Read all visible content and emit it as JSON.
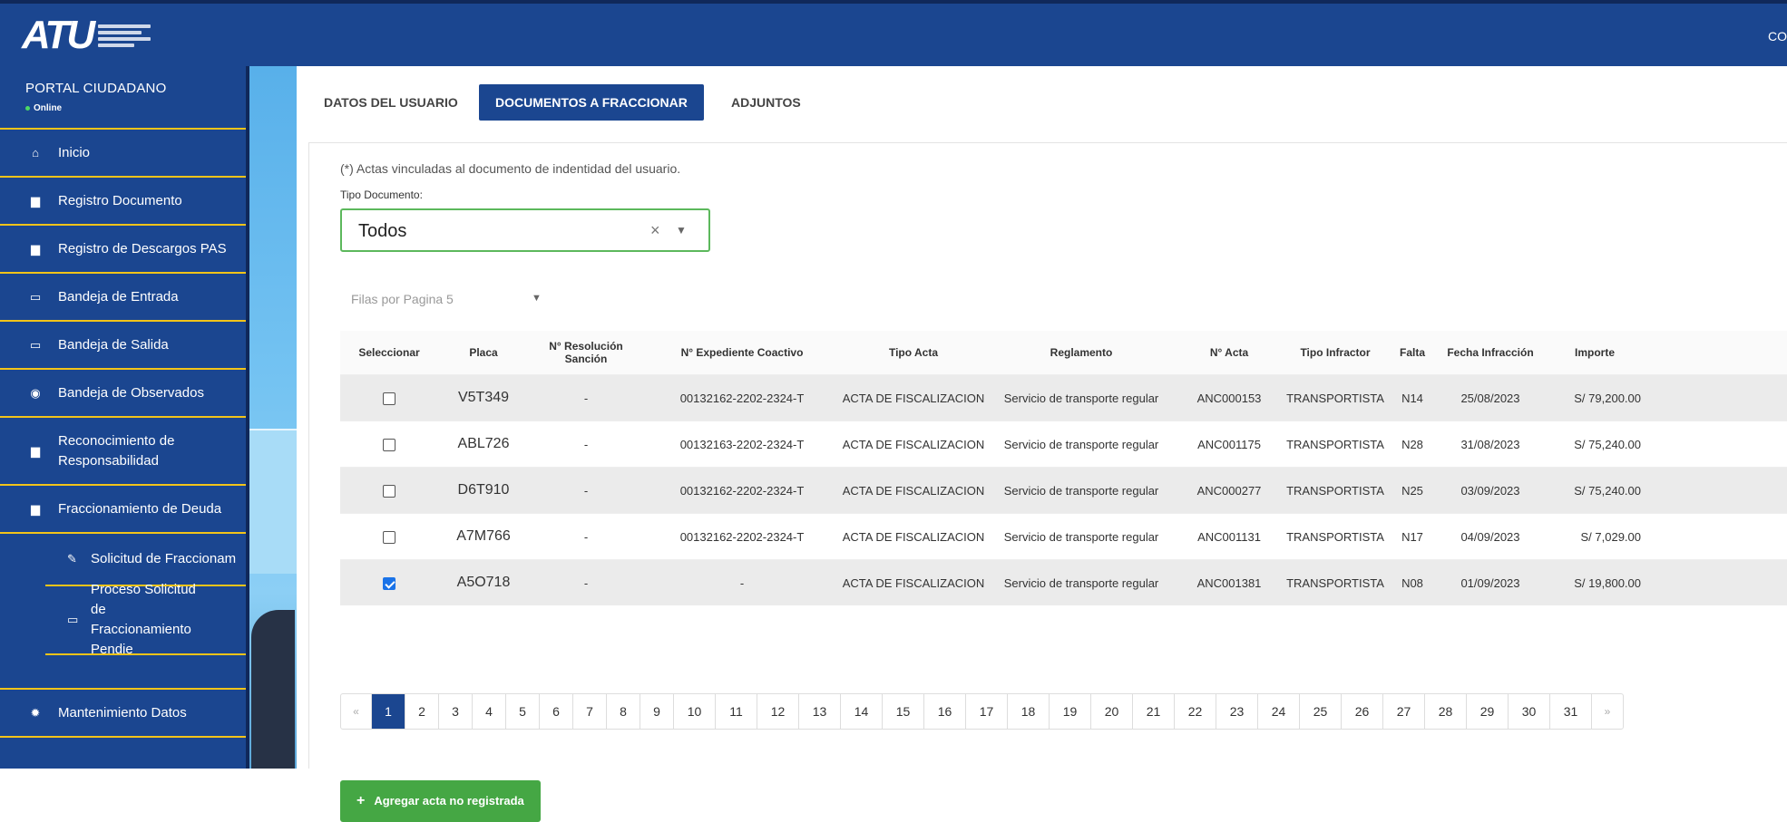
{
  "app": {
    "logo_text": "ATU",
    "top_right": "CO"
  },
  "sidebar": {
    "portal_title": "PORTAL CIUDADANO",
    "status": "Online",
    "items": [
      {
        "label": "Inicio",
        "icon": "home-icon"
      },
      {
        "label": "Registro Documento",
        "icon": "file-icon"
      },
      {
        "label": "Registro de Descargos PAS",
        "icon": "file-icon"
      },
      {
        "label": "Bandeja de Entrada",
        "icon": "inbox-icon"
      },
      {
        "label": "Bandeja de Salida",
        "icon": "inbox-icon"
      },
      {
        "label": "Bandeja de Observados",
        "icon": "eye-icon"
      },
      {
        "label": "Reconocimiento de Responsabilidad",
        "icon": "file-icon"
      },
      {
        "label": "Fraccionamiento de Deuda",
        "icon": "file-icon"
      },
      {
        "label": "Solicitud de Fraccionam",
        "icon": "wrench-icon"
      },
      {
        "label": "Proceso Solicitud de Fraccionamiento Pendie",
        "icon": "inbox-icon"
      },
      {
        "label": "Mantenimiento Datos",
        "icon": "gear-icon"
      }
    ]
  },
  "tabs": [
    {
      "label": "DATOS DEL USUARIO"
    },
    {
      "label": "DOCUMENTOS A FRACCIONAR"
    },
    {
      "label": "ADJUNTOS"
    }
  ],
  "form": {
    "note": "(*) Actas vinculadas al documento de indentidad del usuario.",
    "tipo_label": "Tipo Documento:",
    "tipo_value": "Todos",
    "clear": "×",
    "rows_per_page": "Filas por Pagina 5"
  },
  "table": {
    "headers": [
      "Seleccionar",
      "Placa",
      "N° Resolución Sanción",
      "N° Expediente Coactivo",
      "Tipo Acta",
      "Reglamento",
      "N° Acta",
      "Tipo Infractor",
      "Falta",
      "Fecha Infracción",
      "Importe"
    ],
    "rows": [
      {
        "checked": false,
        "placa": "V5T349",
        "resolucion": "-",
        "expediente": "00132162-2202-2324-T",
        "tipo_acta": "ACTA DE FISCALIZACION",
        "reglamento": "Servicio de transporte regular",
        "acta": "ANC000153",
        "infractor": "TRANSPORTISTA",
        "falta": "N14",
        "fecha": "25/08/2023",
        "importe": "S/ 79,200.00"
      },
      {
        "checked": false,
        "placa": "ABL726",
        "resolucion": "-",
        "expediente": "00132163-2202-2324-T",
        "tipo_acta": "ACTA DE FISCALIZACION",
        "reglamento": "Servicio de transporte regular",
        "acta": "ANC001175",
        "infractor": "TRANSPORTISTA",
        "falta": "N28",
        "fecha": "31/08/2023",
        "importe": "S/ 75,240.00"
      },
      {
        "checked": false,
        "placa": "D6T910",
        "resolucion": "-",
        "expediente": "00132162-2202-2324-T",
        "tipo_acta": "ACTA DE FISCALIZACION",
        "reglamento": "Servicio de transporte regular",
        "acta": "ANC000277",
        "infractor": "TRANSPORTISTA",
        "falta": "N25",
        "fecha": "03/09/2023",
        "importe": "S/ 75,240.00"
      },
      {
        "checked": false,
        "placa": "A7M766",
        "resolucion": "-",
        "expediente": "00132162-2202-2324-T",
        "tipo_acta": "ACTA DE FISCALIZACION",
        "reglamento": "Servicio de transporte regular",
        "acta": "ANC001131",
        "infractor": "TRANSPORTISTA",
        "falta": "N17",
        "fecha": "04/09/2023",
        "importe": "S/ 7,029.00"
      },
      {
        "checked": true,
        "placa": "A5O718",
        "resolucion": "-",
        "expediente": "-",
        "tipo_acta": "ACTA DE FISCALIZACION",
        "reglamento": "Servicio de transporte regular",
        "acta": "ANC001381",
        "infractor": "TRANSPORTISTA",
        "falta": "N08",
        "fecha": "01/09/2023",
        "importe": "S/ 19,800.00"
      }
    ]
  },
  "pagination": {
    "prev": "«",
    "next": "»",
    "active": "1",
    "pages": [
      "1",
      "2",
      "3",
      "4",
      "5",
      "6",
      "7",
      "8",
      "9",
      "10",
      "11",
      "12",
      "13",
      "14",
      "15",
      "16",
      "17",
      "18",
      "19",
      "20",
      "21",
      "22",
      "23",
      "24",
      "25",
      "26",
      "27",
      "28",
      "29",
      "30",
      "31"
    ]
  },
  "actions": {
    "add_label": "Agregar acta no registrada"
  },
  "colors": {
    "primary": "#1b4690",
    "accent": "#f3c419",
    "success": "#45a744"
  }
}
